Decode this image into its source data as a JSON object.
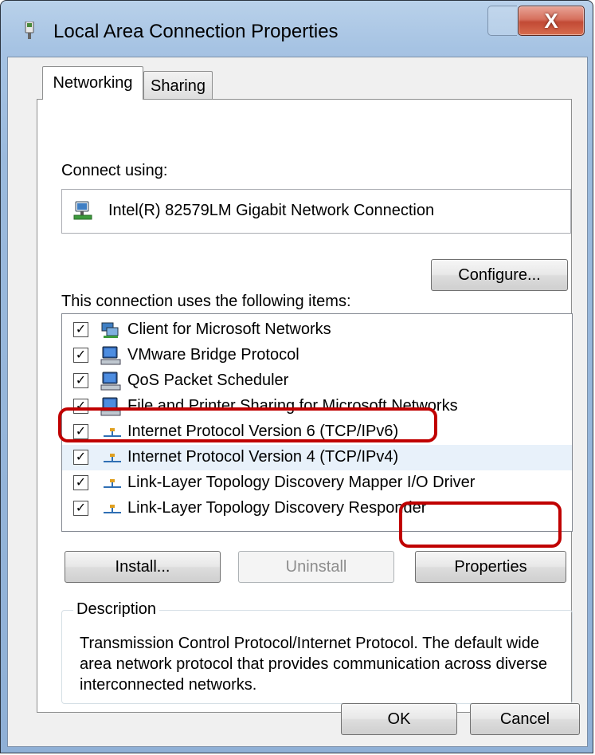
{
  "window": {
    "title": "Local Area Connection Properties",
    "close_label": "X"
  },
  "tabs": [
    {
      "label": "Networking"
    },
    {
      "label": "Sharing"
    }
  ],
  "connect_using": {
    "label": "Connect using:",
    "adapter_name": "Intel(R) 82579LM Gigabit Network Connection",
    "adapter_icon": "network-adapter-icon"
  },
  "configure_label": "Configure...",
  "items_label": "This connection uses the following items:",
  "items": [
    {
      "label": "Client for Microsoft Networks",
      "checked": true,
      "icon": "network-client-icon"
    },
    {
      "label": "VMware Bridge Protocol",
      "checked": true,
      "icon": "network-service-icon"
    },
    {
      "label": "QoS Packet Scheduler",
      "checked": true,
      "icon": "network-service-icon"
    },
    {
      "label": "File and Printer Sharing for Microsoft Networks",
      "checked": true,
      "icon": "network-service-icon"
    },
    {
      "label": "Internet Protocol Version 6 (TCP/IPv6)",
      "checked": true,
      "icon": "protocol-icon"
    },
    {
      "label": "Internet Protocol Version 4 (TCP/IPv4)",
      "checked": true,
      "icon": "protocol-icon",
      "selected": true
    },
    {
      "label": "Link-Layer Topology Discovery Mapper I/O Driver",
      "checked": true,
      "icon": "protocol-icon"
    },
    {
      "label": "Link-Layer Topology Discovery Responder",
      "checked": true,
      "icon": "protocol-icon"
    }
  ],
  "buttons": {
    "install": "Install...",
    "uninstall": "Uninstall",
    "properties": "Properties",
    "ok": "OK",
    "cancel": "Cancel"
  },
  "description": {
    "legend": "Description",
    "text": "Transmission Control Protocol/Internet Protocol. The default wide area network protocol that provides communication across diverse interconnected networks."
  },
  "colors": {
    "highlight": "#c00000",
    "titlebar": "#a6c3e3",
    "close_button": "#c24a35"
  }
}
